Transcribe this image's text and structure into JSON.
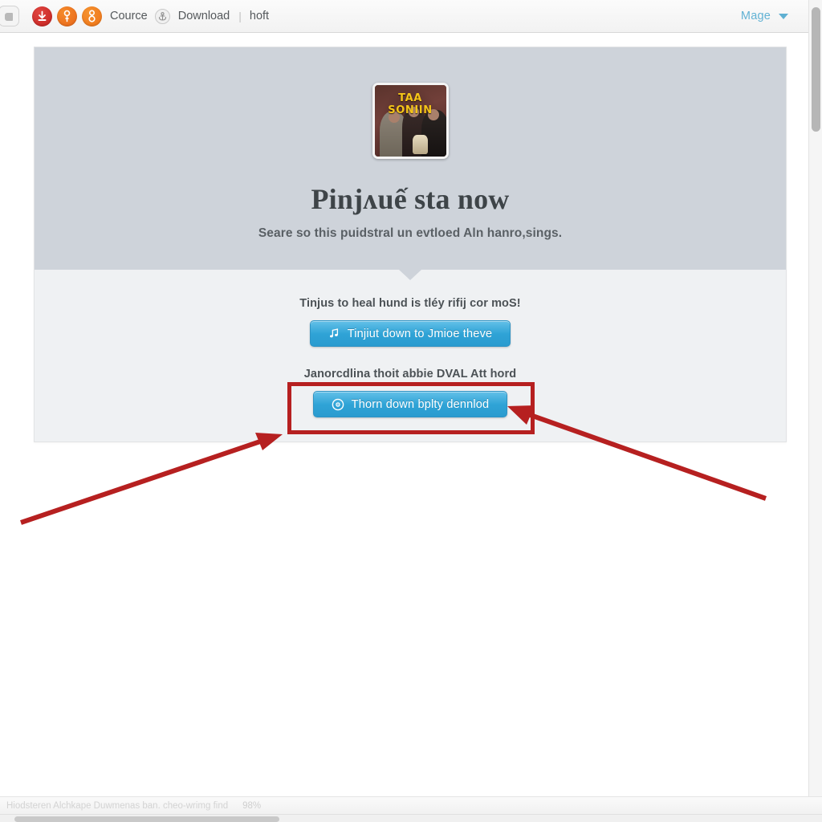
{
  "toolbar": {
    "app_chip_icon": "app-window-icon",
    "badges": [
      {
        "name": "download-badge-icon",
        "color": "#c3211f"
      },
      {
        "name": "key-badge-icon",
        "color": "#e8661a"
      },
      {
        "name": "person-badge-icon",
        "color": "#ee7216"
      }
    ],
    "label_source": "Cource",
    "anchor_icon": "anchor-circle-icon",
    "label_download": "Download",
    "separator": "|",
    "label_host": "hoft",
    "account_label": "Mage",
    "account_caret_icon": "chevron-down-icon"
  },
  "card": {
    "thumbnail": {
      "overlay_title": "TAA SONIIN",
      "overlay_color": "#f5c518",
      "alt": "three people holding a bouquet"
    },
    "hero_title": "Pinjʌuế sta now",
    "hero_subtitle": "Seare so this puidstral un evtloed Aln hanro,sings.",
    "notch_icon": "down-triangle-notch-icon",
    "promo_primary": "Tinjus to heal hund is tléy rifij cor moS!",
    "button_primary": {
      "icon": "music-note-icon",
      "label": "Tinjiut down to Jmioe theve"
    },
    "promo_secondary": "Janorcdlina thoit abbie DVAL Att hord",
    "button_secondary": {
      "icon": "disc-icon",
      "label": "Thorn down bplty dennlod"
    }
  },
  "annotations": {
    "highlight_color": "#b62020",
    "highlight_target": "button-secondary",
    "arrow_left_name": "arrow-pointing-to-highlight-left",
    "arrow_right_name": "arrow-pointing-to-button-right"
  },
  "statusbar": {
    "text": "Hiodsteren Alchkape Duwmenas ban. cheo-wrimg find",
    "zoom": "98%"
  },
  "scrollbars": {
    "vertical_thumb_name": "vertical-scrollbar-thumb",
    "horizontal_thumb_name": "horizontal-scrollbar-thumb"
  }
}
